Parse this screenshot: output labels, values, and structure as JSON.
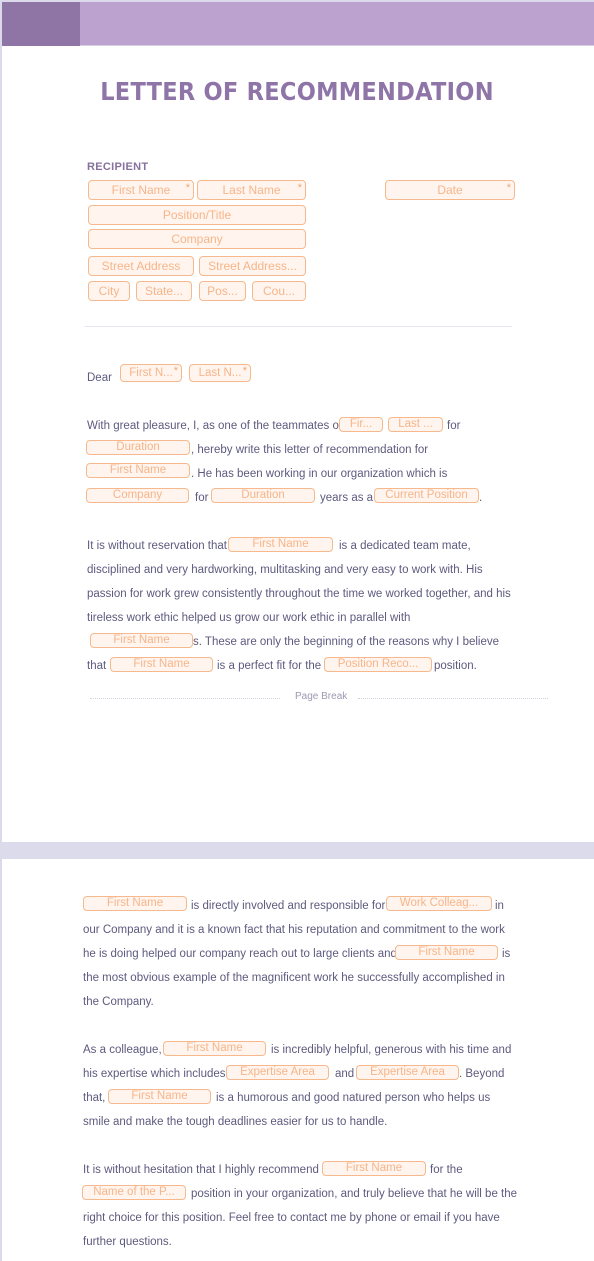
{
  "document": {
    "title": "LETTER OF RECOMMENDATION",
    "colors": {
      "header_band": "#bca3cf",
      "header_accent": "#8f75a5",
      "title": "#8f74a8",
      "field_border": "#f5b98d",
      "field_fill": "#fff5ee",
      "field_text": "#f6b58a",
      "body_text": "#5d5a7e",
      "page_gap": "#dcdbeb"
    }
  },
  "recipient": {
    "label": "RECIPIENT",
    "first_name": "First Name",
    "last_name": "Last Name",
    "date": "Date",
    "position_title": "Position/Title",
    "company": "Company",
    "street_address": "Street Address",
    "street_address_2": "Street Address...",
    "city": "City",
    "state": "State...",
    "postal": "Pos...",
    "country": "Cou...",
    "required_marker": "*"
  },
  "salutation": {
    "dear": "Dear",
    "first_name": "First N...",
    "last_name": "Last N..."
  },
  "paragraph1": {
    "t1": "With great pleasure, I, as one of the teammates of",
    "f_first": "Fir...",
    "f_last": "Last ...",
    "t2": "for",
    "f_duration": "Duration",
    "t3": ", hereby write this letter of recommendation for",
    "f_first_name": "First Name",
    "t4": ". He has been working in our organization which is",
    "f_company": "Company",
    "t5": "for",
    "f_duration2": "Duration",
    "t6": "years as a",
    "f_current_position": "Current Position",
    "t7": "."
  },
  "paragraph2": {
    "t1": "It is without reservation that",
    "f_first_name": "First Name",
    "t2": "is a dedicated team mate,",
    "l2": "disciplined and very hardworking, multitasking and very easy to work with. His",
    "l3": "passion for work grew consistently throughout the time we worked together, and his",
    "l4": "tireless work ethic helped us grow our work ethic in parallel with",
    "f_first_name2": "First Name",
    "t5": "s. These are only the beginning of the reasons why I believe",
    "t6": "that",
    "f_first_name3": "First Name",
    "t7": "is a perfect fit for the",
    "f_position_rec": "Position Reco...",
    "t8": "position."
  },
  "page_break": {
    "label": "Page Break"
  },
  "paragraph3": {
    "f_first_name": "First Name",
    "t1": "is directly involved and responsible for",
    "f_work_colleague": "Work Colleag...",
    "t2": "in",
    "l2": "our Company and it is a known fact that his reputation and commitment to the work",
    "l3": "he is doing helped our company reach out to large clients and",
    "f_first_name2": "First Name",
    "t3": "is",
    "l4": "the most obvious example of the magnificent work he successfully accomplished in",
    "l5": "the Company."
  },
  "paragraph4": {
    "t1": "As a colleague,",
    "f_first_name": "First Name",
    "t2": "is incredibly helpful, generous with his time and",
    "t3": "his expertise which includes",
    "f_expertise1": "Expertise Area",
    "t4": "and",
    "f_expertise2": "Expertise Area",
    "t5": ". Beyond",
    "t6": "that,",
    "f_first_name2": "First Name",
    "t7": "is a humorous and good natured person who helps us",
    "l4": "smile and make the tough deadlines easier for us to handle."
  },
  "paragraph5": {
    "t1": "It is without hesitation that I highly recommend",
    "f_first_name": "First Name",
    "t2": "for the",
    "f_name_position": "Name of the P...",
    "t3": "position in your organization, and truly believe that he will be the",
    "l3": "right choice for this position. Feel free to contact me by phone or email if you have",
    "l4": "further questions."
  }
}
